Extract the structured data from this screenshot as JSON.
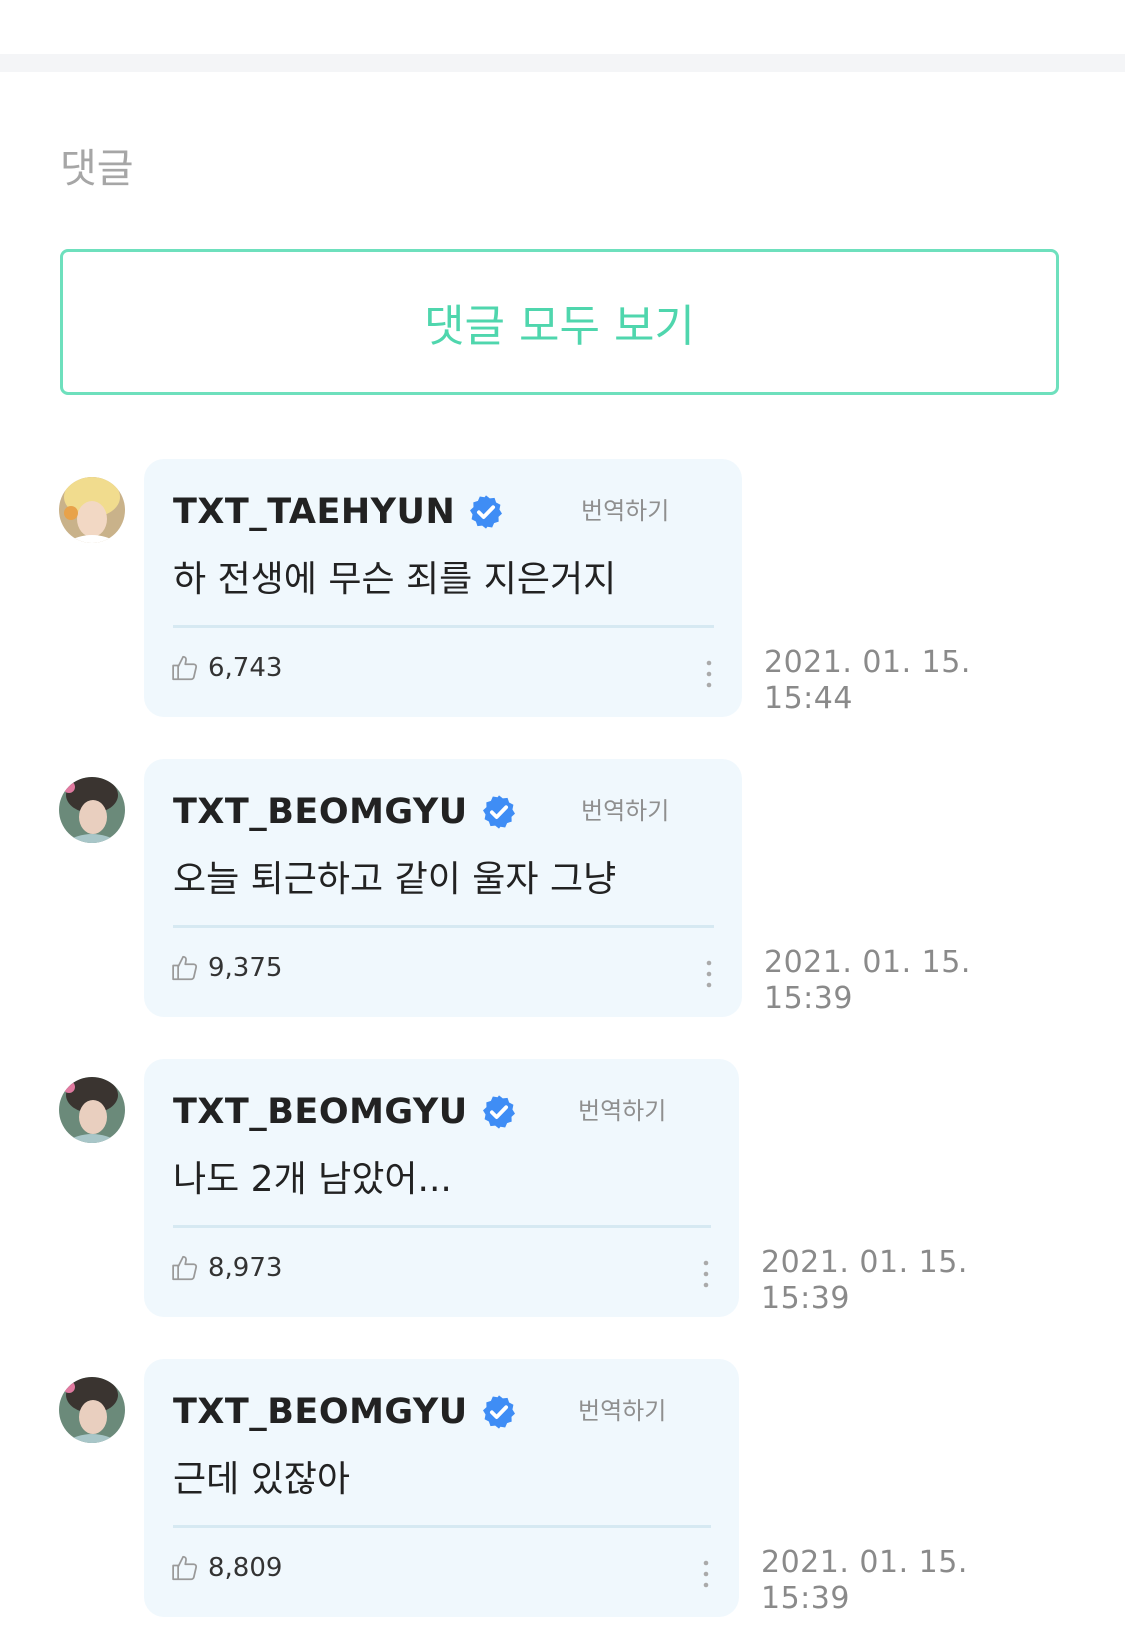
{
  "section": {
    "title": "댓글",
    "view_all_label": "댓글 모두 보기"
  },
  "colors": {
    "accent": "#4fd6ad",
    "verified": "#3f8df5",
    "bubble": "#f0f8fd"
  },
  "comments": [
    {
      "author": "TXT_TAEHYUN",
      "translate": "번역하기",
      "text": "하 전생에 무슨 죄를 지은거지",
      "likes": "6,743",
      "date": "2021. 01. 15.",
      "time": "15:44"
    },
    {
      "author": "TXT_BEOMGYU",
      "translate": "번역하기",
      "text": "오늘 퇴근하고 같이 울자 그냥",
      "likes": "9,375",
      "date": "2021. 01. 15.",
      "time": "15:39"
    },
    {
      "author": "TXT_BEOMGYU",
      "translate": "번역하기",
      "text": "나도 2개 남았어...",
      "likes": "8,973",
      "date": "2021. 01. 15.",
      "time": "15:39"
    },
    {
      "author": "TXT_BEOMGYU",
      "translate": "번역하기",
      "text": "근데 있잖아",
      "likes": "8,809",
      "date": "2021. 01. 15.",
      "time": "15:39"
    }
  ]
}
